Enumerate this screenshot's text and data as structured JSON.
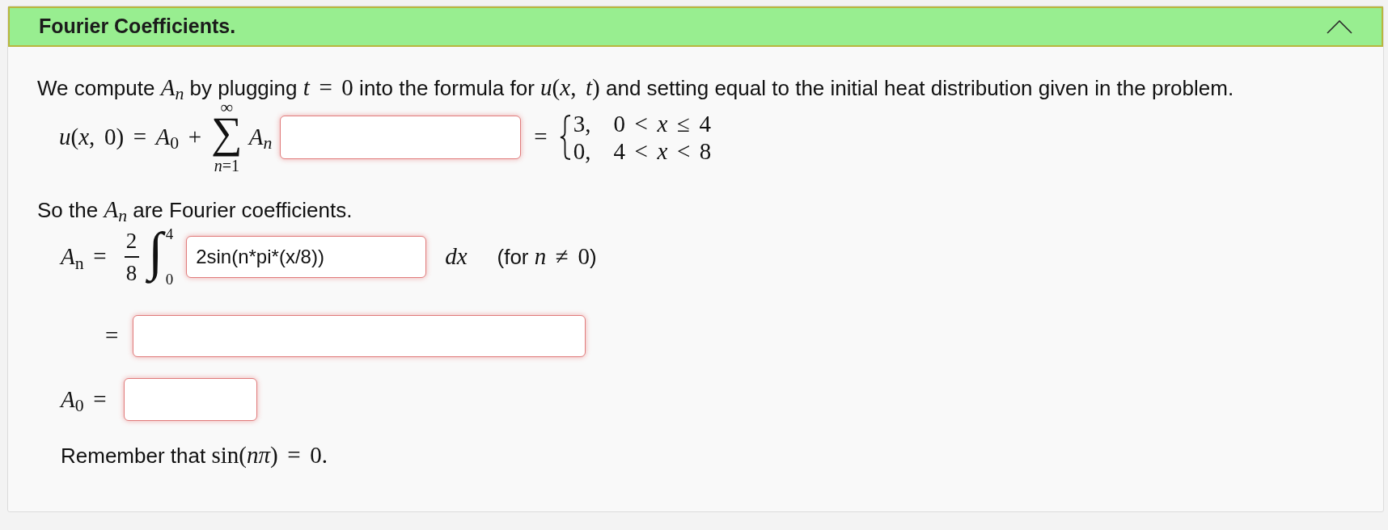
{
  "section": {
    "title": "Fourier Coefficients.",
    "expanded": true
  },
  "intro": [
    {
      "kind": "text",
      "s": "We compute "
    },
    {
      "kind": "var",
      "s": "A$_{n}$"
    },
    {
      "kind": "text",
      "s": " by plugging "
    },
    {
      "kind": "math",
      "s": "*t* = 0"
    },
    {
      "kind": "text",
      "s": " into the formula for "
    },
    {
      "kind": "math",
      "s": "*u*(*x*, *t*)"
    },
    {
      "kind": "text",
      "s": " and setting equal to the initial heat distribution given in the problem."
    }
  ],
  "series_equation": {
    "lhs": "*u*(*x*, 0) = *A*$_{0}$ +",
    "sum_symbol": "∑",
    "sum_upper": "∞",
    "sum_lower": "*n*=1",
    "term": "A$_{n}$",
    "answer": {
      "incorrect": true
    },
    "equals": "=",
    "cases": [
      {
        "value": "3,",
        "condition": "0 < *x* ≤ 4"
      },
      {
        "value": "0,",
        "condition": "4 < *x* < 8"
      }
    ]
  },
  "note": [
    {
      "kind": "text",
      "s": "So the "
    },
    {
      "kind": "var",
      "s": "A$_{n}$"
    },
    {
      "kind": "text",
      "s": " are Fourier coefficients."
    }
  ],
  "integral_equation": {
    "lhs": "*A*$_{n}$ =",
    "numerator": "2",
    "denominator": "8",
    "integral_symbol": "∫",
    "upper": "4",
    "lower": "0",
    "answer": {
      "value": "2sin(n*pi*(x/8))",
      "incorrect": true
    },
    "differential": "dx",
    "condition": [
      {
        "kind": "text",
        "s": "(for "
      },
      {
        "kind": "math",
        "s": "*n* ≠ 0"
      },
      {
        "kind": "text",
        "s": ")"
      }
    ]
  },
  "result_equation": {
    "equals": "=",
    "answer": {
      "incorrect": true
    }
  },
  "a0_equation": {
    "lhs": "*A*$_{0}$ =",
    "answer": {
      "incorrect": true
    }
  },
  "reminder": [
    {
      "kind": "text",
      "s": "Remember that "
    },
    {
      "kind": "math",
      "s": "sin(*nπ*) = 0."
    }
  ]
}
